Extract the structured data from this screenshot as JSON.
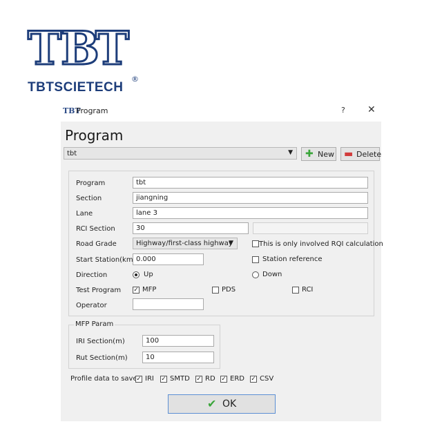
{
  "logo": {
    "letters": [
      "T",
      "B",
      "T"
    ],
    "brand": "TBTSCIETECH",
    "registered": "®"
  },
  "window": {
    "icon_text": "TBT",
    "title": "Program",
    "help": "?",
    "close": "✕"
  },
  "heading": "Program",
  "program_select": {
    "value": "tbt"
  },
  "buttons": {
    "new_label": "New",
    "delete_label": "Delete",
    "ok_label": "OK"
  },
  "form": {
    "program": {
      "label": "Program",
      "value": "tbt"
    },
    "section": {
      "label": "Section",
      "value": "jiangning"
    },
    "lane": {
      "label": "Lane",
      "value": "lane 3"
    },
    "rci_section": {
      "label": "RCI Section",
      "value": "30"
    },
    "road_grade": {
      "label": "Road Grade",
      "value": "Highway/first-class highway"
    },
    "rqi_only": {
      "label": "This is only involved RQI calculation",
      "checked": false
    },
    "start_station": {
      "label": "Start Station(km)",
      "value": "0.000"
    },
    "station_reference": {
      "label": "Station reference",
      "checked": false
    },
    "direction": {
      "label": "Direction",
      "options": [
        "Up",
        "Down"
      ],
      "selected": "Up"
    },
    "test_program": {
      "label": "Test Program",
      "options": [
        {
          "name": "MFP",
          "checked": true
        },
        {
          "name": "PDS",
          "checked": false
        },
        {
          "name": "RCI",
          "checked": false
        }
      ]
    },
    "operator": {
      "label": "Operator",
      "value": ""
    }
  },
  "mfp_param": {
    "title": "MFP Param",
    "iri_section": {
      "label": "IRI Section(m)",
      "value": "100"
    },
    "rut_section": {
      "label": "Rut Section(m)",
      "value": "10"
    }
  },
  "profile": {
    "label": "Profile data to save",
    "items": [
      {
        "name": "IRI",
        "checked": true
      },
      {
        "name": "SMTD",
        "checked": true
      },
      {
        "name": "RD",
        "checked": true
      },
      {
        "name": "ERD",
        "checked": true
      },
      {
        "name": "CSV",
        "checked": true
      }
    ]
  },
  "colors": {
    "brand": "#1d3d7a",
    "dialog_bg": "#f0f0f0",
    "new_icon": "#3aa53a",
    "delete_icon": "#d23b3b"
  }
}
